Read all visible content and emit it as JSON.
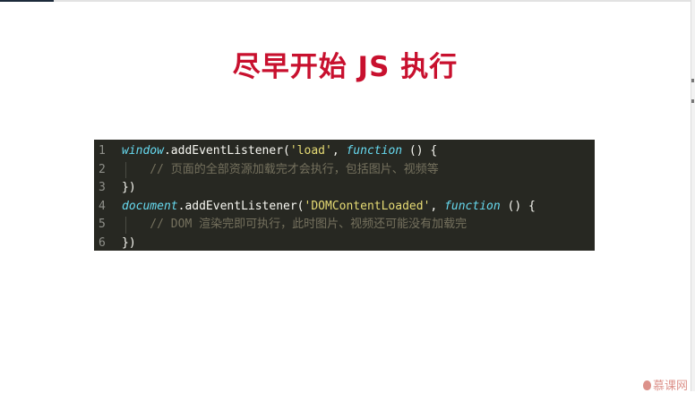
{
  "slide": {
    "title": "尽早开始 JS 执行"
  },
  "code": {
    "lines": [
      {
        "num": "1",
        "tokens": [
          {
            "t": "window",
            "c": "kw"
          },
          {
            "t": ".addEventListener(",
            "c": "pn"
          },
          {
            "t": "'load'",
            "c": "str"
          },
          {
            "t": ", ",
            "c": "pn"
          },
          {
            "t": "function",
            "c": "kw"
          },
          {
            "t": " () {",
            "c": "pn"
          }
        ]
      },
      {
        "num": "2",
        "tokens": [
          {
            "t": "    // 页面的全部资源加载完才会执行，包括图片、视频等",
            "c": "cm"
          }
        ]
      },
      {
        "num": "3",
        "tokens": [
          {
            "t": "})",
            "c": "pn"
          }
        ]
      },
      {
        "num": "4",
        "tokens": [
          {
            "t": "document",
            "c": "kw"
          },
          {
            "t": ".addEventListener(",
            "c": "pn"
          },
          {
            "t": "'DOMContentLoaded'",
            "c": "str"
          },
          {
            "t": ", ",
            "c": "pn"
          },
          {
            "t": "function",
            "c": "kw"
          },
          {
            "t": " () {",
            "c": "pn"
          }
        ]
      },
      {
        "num": "5",
        "tokens": [
          {
            "t": "    // DOM 渲染完即可执行，此时图片、视频还可能没有加载完",
            "c": "cm"
          }
        ]
      },
      {
        "num": "6",
        "tokens": [
          {
            "t": "})",
            "c": "pn"
          }
        ]
      }
    ]
  },
  "watermark": {
    "text": "慕课网",
    "icon": "flame-icon",
    "color": "#c0392b"
  },
  "colors": {
    "title": "#c8102e",
    "code_bg": "#272822",
    "keyword": "#66d9ef",
    "string": "#e6db74",
    "comment": "#75715e",
    "line_number": "#8f908a"
  }
}
